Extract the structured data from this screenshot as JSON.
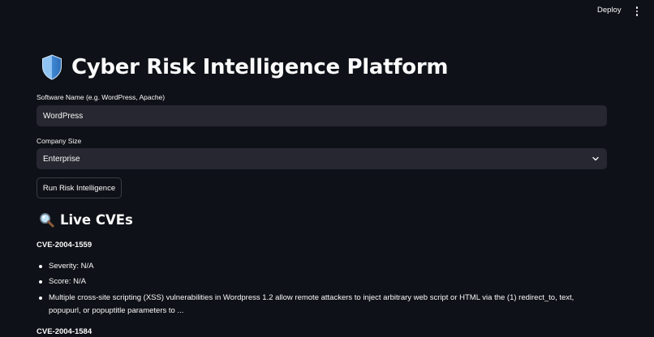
{
  "header": {
    "deploy_label": "Deploy",
    "menu_icon": "more-vertical-icon"
  },
  "page": {
    "title_icon": "shield-icon",
    "title": "Cyber Risk Intelligence Platform"
  },
  "form": {
    "software_label": "Software Name (e.g. WordPress, Apache)",
    "software_value": "WordPress",
    "company_size_label": "Company Size",
    "company_size_value": "Enterprise",
    "run_button_label": "Run Risk Intelligence"
  },
  "cves_section": {
    "icon": "magnifier-icon",
    "title": "Live CVEs",
    "items": [
      {
        "id": "CVE-2004-1559",
        "severity": "Severity: N/A",
        "score": "Score: N/A",
        "description": "Multiple cross-site scripting (XSS) vulnerabilities in Wordpress 1.2 allow remote attackers to inject arbitrary web script or HTML via the (1) redirect_to, text, popupurl, or popuptitle parameters to ..."
      },
      {
        "id": "CVE-2004-1584"
      }
    ]
  },
  "colors": {
    "background": "#0e1117",
    "input_background": "#262730",
    "text": "#fafafa",
    "shield": "#4a90d9"
  }
}
